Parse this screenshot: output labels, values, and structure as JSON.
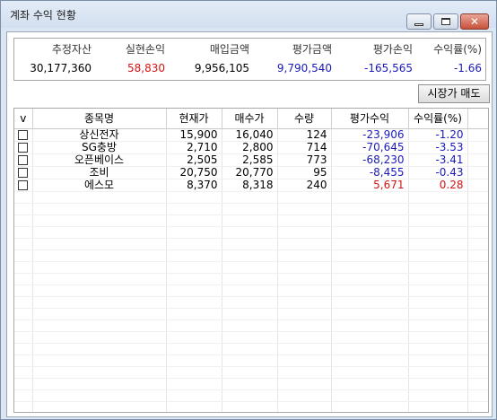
{
  "window": {
    "title": "계좌 수익 현황"
  },
  "colors": {
    "negative": "#1a1ab8",
    "positive": "#d21414"
  },
  "summary": {
    "headers": [
      "추정자산",
      "실현손익",
      "매입금액",
      "평가금액",
      "평가손익",
      "수익률(%)"
    ],
    "values": [
      "30,177,360",
      "58,830",
      "9,956,105",
      "9,790,540",
      "-165,565",
      "-1.66"
    ]
  },
  "toolbar": {
    "sell_label": "시장가 매도"
  },
  "grid": {
    "headers": [
      "v",
      "종목명",
      "현재가",
      "매수가",
      "수량",
      "평가수익",
      "수익률(%)"
    ],
    "rows": [
      {
        "name": "상신전자",
        "price": "15,900",
        "buy": "16,040",
        "qty": "124",
        "profit": "-23,906",
        "rate": "-1.20"
      },
      {
        "name": "SG충방",
        "price": "2,710",
        "buy": "2,800",
        "qty": "714",
        "profit": "-70,645",
        "rate": "-3.53"
      },
      {
        "name": "오픈베이스",
        "price": "2,505",
        "buy": "2,585",
        "qty": "773",
        "profit": "-68,230",
        "rate": "-3.41"
      },
      {
        "name": "조비",
        "price": "20,750",
        "buy": "20,770",
        "qty": "95",
        "profit": "-8,455",
        "rate": "-0.43"
      },
      {
        "name": "에스모",
        "price": "8,370",
        "buy": "8,318",
        "qty": "240",
        "profit": "5,671",
        "rate": "0.28"
      }
    ]
  }
}
